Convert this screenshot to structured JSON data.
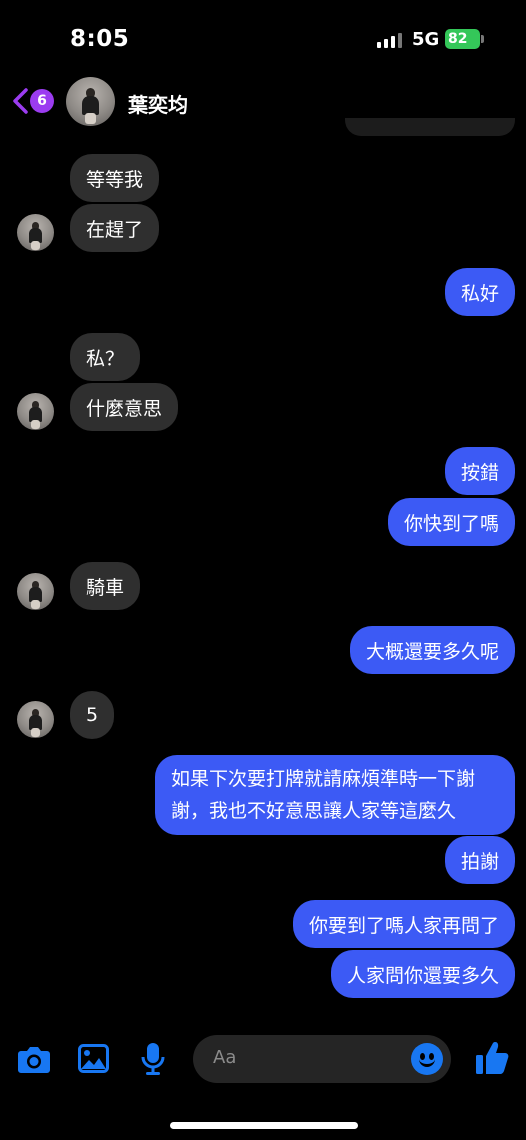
{
  "status_bar": {
    "time": "8:05",
    "network": "5G",
    "battery": "82"
  },
  "header": {
    "back_badge": "6",
    "contact_name": "葉奕均"
  },
  "messages": [
    {
      "from": "them",
      "text": "等等我"
    },
    {
      "from": "them",
      "text": "在趕了"
    },
    {
      "from": "me",
      "text": "私好"
    },
    {
      "from": "them",
      "text": "私？"
    },
    {
      "from": "them",
      "text": "什麼意思"
    },
    {
      "from": "me",
      "text": "按錯"
    },
    {
      "from": "me",
      "text": "你快到了嗎"
    },
    {
      "from": "them",
      "text": "騎車"
    },
    {
      "from": "me",
      "text": "大概還要多久呢"
    },
    {
      "from": "them",
      "text": "5"
    },
    {
      "from": "me",
      "text": "如果下次要打牌就請麻煩準時一下謝謝，我也不好意思讓人家等這麼久"
    },
    {
      "from": "me",
      "text": "拍謝"
    },
    {
      "from": "me",
      "text": "你要到了嗎人家再問了"
    },
    {
      "from": "me",
      "text": "人家問你還要多久"
    }
  ],
  "composer": {
    "placeholder": "Aa"
  },
  "colors": {
    "sent_bubble": "#3c5af5",
    "received_bubble": "#2f2f2f",
    "accent": "#1877f2",
    "badge": "#9b3cf0"
  },
  "icons": [
    "camera-icon",
    "photo-icon",
    "microphone-icon",
    "emoji-icon",
    "thumbs-up-icon"
  ]
}
